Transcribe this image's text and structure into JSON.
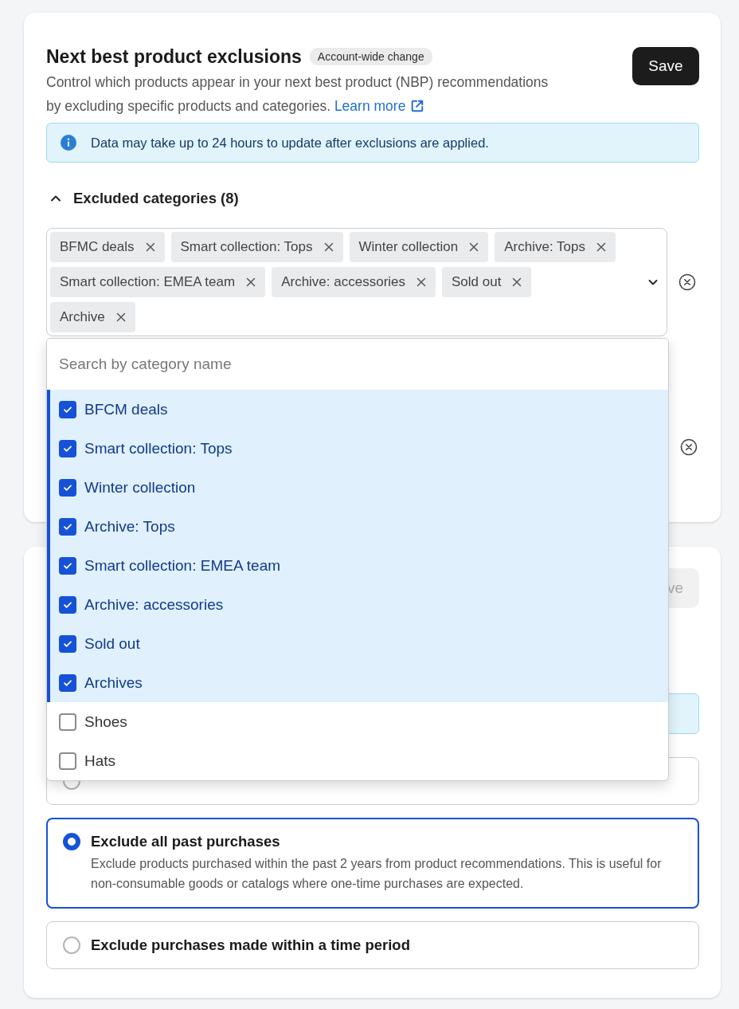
{
  "header": {
    "title": "Next best product exclusions",
    "badge": "Account-wide change",
    "description": "Control which products appear in your next best product (NBP) recommendations by excluding specific products and categories.",
    "link": "Learn more",
    "button": "Save"
  },
  "notice": "Data may take up to 24 hours to update after exclusions are applied.",
  "section": {
    "title": "Excluded categories (8)",
    "expanded": true
  },
  "chips": [
    "BFMC deals",
    "Smart collection: Tops",
    "Winter collection",
    "Archive: Tops",
    "Smart collection: EMEA team",
    "Archive: accessories",
    "Sold out",
    "Archive"
  ],
  "dropdown": {
    "placeholder": "Search by category name",
    "options": [
      {
        "label": "BFCM deals",
        "checked": true
      },
      {
        "label": "Smart collection: Tops",
        "checked": true
      },
      {
        "label": "Winter collection",
        "checked": true
      },
      {
        "label": "Archive: Tops",
        "checked": true
      },
      {
        "label": "Smart collection: EMEA team",
        "checked": true
      },
      {
        "label": "Archive: accessories",
        "checked": true
      },
      {
        "label": "Sold out",
        "checked": true
      },
      {
        "label": "Archives",
        "checked": true
      },
      {
        "label": "Shoes",
        "checked": false
      },
      {
        "label": "Hats",
        "checked": false
      }
    ]
  },
  "card2": {
    "button": "ve",
    "options": [
      {
        "selected": false
      },
      {
        "title": "Exclude all past purchases",
        "selected": true,
        "description": "Exclude products purchased within the past 2 years from product recommendations. This is useful for non-consumable goods or catalogs where one-time purchases are expected."
      },
      {
        "title": "Exclude purchases made within a time period",
        "selected": false
      }
    ]
  }
}
